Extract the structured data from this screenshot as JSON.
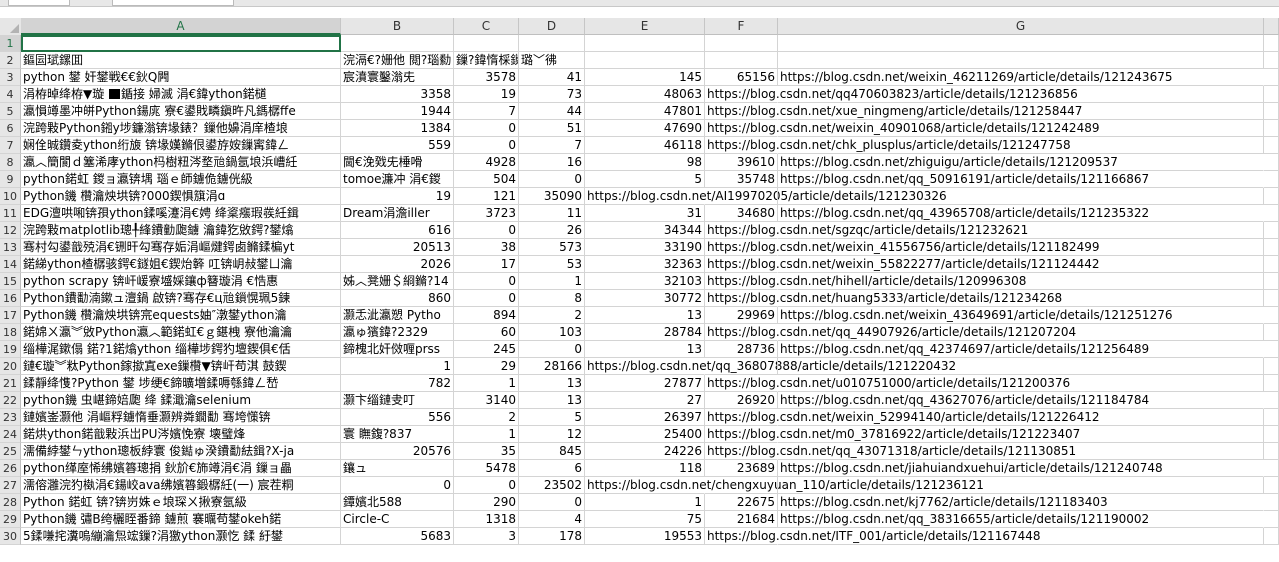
{
  "column_headers": [
    "A",
    "B",
    "C",
    "D",
    "E",
    "F",
    "G"
  ],
  "rows": [
    {
      "n": "1",
      "A": "",
      "B": "",
      "C": "",
      "D": "",
      "E": "",
      "F": "",
      "G": ""
    },
    {
      "n": "2",
      "A": "鏂囩珷鏍囬",
      "B": "浣滆€?姗他  閲?瑙勬",
      "C": "鏁?鍏惰棌鏁?",
      "D": "璐﹀彿",
      "E": "",
      "F": "",
      "G": ""
    },
    {
      "n": "3",
      "A": "python 鐢  奸鐢戦€€鈥Q闁",
      "B": "宸濆寰鑿滃兂",
      "C": "3578",
      "D": "41",
      "E": "145",
      "F": "65156",
      "G": "https://blog.csdn.net/weixin_46211269/article/details/121243675"
    },
    {
      "n": "4",
      "A": "涓栫晫绛栫▼璇  [■]鍎接  婦滅  涓€鍏ython鍩檤",
      "B": "3358",
      "C": "19",
      "D": "73",
      "E": "48063",
      "F": "https://blog.csdn.net/qq470603823/article/details/121236856",
      "G": ""
    },
    {
      "n": "5",
      "A": "瀛愪竴墨冲皏Python鍚庣  寮€鍙戝疄鎭旿凡鎷樼ffe",
      "B": "1944",
      "C": "7",
      "D": "44",
      "E": "47801",
      "F": "https://blog.csdn.net/xue_ningmeng/article/details/121258447",
      "G": ""
    },
    {
      "n": "6",
      "A": "浣跨敤Python鎺у埗鐮滃锛堟錶？鏁他嬶涓庠楂埌",
      "B": "1384",
      "C": "0",
      "D": "51",
      "E": "47690",
      "F": "https://blog.csdn.net/weixin_40901068/article/details/121242489",
      "G": ""
    },
    {
      "n": "7",
      "A": "娴佺晠鑽夌ython绗旇  锛堟嫨鏅佷鍙斿姲鏁寗鍏ㄥ",
      "B": "559",
      "C": "0",
      "D": "7",
      "E": "46118",
      "F": "https://blog.csdn.net/chk_plusplus/article/details/121247758",
      "G": ""
    },
    {
      "n": "8",
      "A": "瀛︿簡閬ｄ簺浠庨ython杩樹粈涔堥兘鍋氬埌浜嶆紝",
      "B": "閫€浼戣兂棰嗗",
      "C": "4928",
      "D": "16",
      "E": "98",
      "F": "39610",
      "G": "https://blog.csdn.net/zhiguigu/article/details/121209537"
    },
    {
      "n": "9",
      "A": "python鍩虹  鍐ョ瀛锛堣  瑙ｅ師鐪佹鐪侊級",
      "B": "tomoe濂冲  涓€鍐",
      "C": "504",
      "D": "0",
      "E": "5",
      "F": "35748",
      "G": "https://blog.csdn.net/qq_50916191/article/details/121166867"
    },
    {
      "n": "10",
      "A": "Python鐖  欑瀹炴垬锛?000鍥惧簱涓ɑ",
      "B": "19",
      "C": "121",
      "D": "35090",
      "E": "https://blog.csdn.net/AI19970205/article/details/121230326",
      "F": "",
      "G": ""
    },
    {
      "n": "11",
      "A": "EDG澶哄啝锛孭ython鍒嗘瀽涓€娉  绛楶瘬瑕彂紝鍓",
      "B": "Dream涓澹iller",
      "C": "3723",
      "D": "11",
      "E": "31",
      "F": "34680",
      "G": "https://blog.csdn.net/qq_43965708/article/details/121235322"
    },
    {
      "n": "12",
      "A": "浣跨敤matplotlib璁╀綘鐨勭瓟鐪  瀹鍏犵敓鍔?鐢熻",
      "B": "616",
      "C": "0",
      "D": "26",
      "E": "34344",
      "F": "https://blog.csdn.net/sgzqc/article/details/121232621",
      "G": ""
    },
    {
      "n": "13",
      "A": "骞村勾鍙戠殑涓€铏旰勾骞存姤涓嶇煡鍔卥鏅鍒楄yt",
      "B": "20513",
      "C": "38",
      "D": "573",
      "E": "33190",
      "F": "https://blog.csdn.net/weixin_41556756/article/details/121182499",
      "G": ""
    },
    {
      "n": "14",
      "A": "鍩綈ython楂樼骇鍔€鐩姐€鍥炲簳  叿锛岄敊鐢ㄩ瀹",
      "B": "2026",
      "C": "17",
      "D": "53",
      "E": "32363",
      "F": "https://blog.csdn.net/weixin_55822277/article/details/121124442",
      "G": ""
    },
    {
      "n": "15",
      "A": "python scrapy 锛屽嵈寮墭婇鑲ф簮璇涓  €悎惠",
      "B": "姊︿凳姗＄綗鏅?14",
      "C": "0",
      "D": "1",
      "E": "32103",
      "F": "https://blog.csdn.net/hihell/article/details/120996308",
      "G": ""
    },
    {
      "n": "16",
      "A": "Python鐨勫湳鏉ュ澶鍋  啟锛?骞存€ц兘鎻愰珮5鍊",
      "B": "860",
      "C": "0",
      "D": "8",
      "E": "30772",
      "F": "https://blog.csdn.net/huang5333/article/details/121234268",
      "G": ""
    },
    {
      "n": "17",
      "A": "Python鐖  欑瀹炴垬锛宺equests妯″潡鐢ython瀹",
      "B": "灏忎泚瀛愬  Pytho",
      "C": "894",
      "D": "2",
      "E": "13",
      "F": "29969",
      "G": "https://blog.csdn.net/weixin_43649691/article/details/121251276"
    },
    {
      "n": "18",
      "A": "鍩婂ㄨ瀛︾敓Python瀛︿範鍩虹€ｇ鍖栧  寮他瀹瀹",
      "B": "瀛ゅ獱鍏?2329",
      "C": "60",
      "D": "103",
      "E": "28784",
      "F": "https://blog.csdn.net/qq_44907926/article/details/121207204",
      "G": ""
    },
    {
      "n": "19",
      "A": "缁樺浘鏉傝  鍩?1鍩熻ython 缁樺埗鍔犳壇鍥俱€佸",
      "B": "鍗槐北奸傚喱prss",
      "C": "245",
      "D": "0",
      "E": "13",
      "F": "28736",
      "G": "https://blog.csdn.net/qq_42374697/article/details/121256489"
    },
    {
      "n": "20",
      "A": "鏈€璇︾粏Python鎵撳寘exe鏁欑▼锛屽苟淇  鼓鍥",
      "B": "1",
      "C": "29",
      "D": "28166",
      "E": "https://blog.csdn.net/qq_36807888/article/details/121220432",
      "F": "",
      "G": ""
    },
    {
      "n": "21",
      "A": "鍒靜绛愯?Python 鐢   埗绠€鍗曠増鍒嗕綔鍏ㄥ嵆",
      "B": "782",
      "C": "1",
      "D": "13",
      "E": "27877",
      "F": "https://blog.csdn.net/u010751000/article/details/121200376",
      "G": ""
    },
    {
      "n": "22",
      "A": "python鐖  虫嵁鍗婄瓟  绛  鍒濈瀹selenium",
      "B": "灏卞缁鏈叏叮",
      "C": "3140",
      "D": "13",
      "E": "27",
      "F": "26920",
      "G": "https://blog.csdn.net/qq_43627076/article/details/121184784"
    },
    {
      "n": "23",
      "A": "鏈嬪崟灏他  涓嶇粰鐪惰垂灏辨粦鐗勫  骞垮憡锛",
      "B": "556",
      "C": "2",
      "D": "5",
      "E": "26397",
      "F": "https://blog.csdn.net/weixin_52994140/article/details/121226412",
      "G": ""
    },
    {
      "n": "24",
      "A": "鍩烘ython鍩戠敤浜岀PU涔嬪悗寮  壊璧烽",
      "B": "寰  瞴鍑?837",
      "C": "1",
      "D": "12",
      "E": "25400",
      "F": "https://blog.csdn.net/m0_37816922/article/details/121223407",
      "G": ""
    },
    {
      "n": "25",
      "A": "濡備綍鐢ㄣython璁板綍寰  俊鐑ゅ湀鐨勫紶鍓?X-ja",
      "B": "20576",
      "C": "35",
      "D": "845",
      "E": "24226",
      "F": "https://blog.csdn.net/qq_43071318/article/details/121130851",
      "G": ""
    },
    {
      "n": "26",
      "A": "python缂庢悕绋嬪簭璁捐  鈥斺€斾竴涓€涓  鏁ョ畾",
      "B": "鑲ュ",
      "C": "5478",
      "D": "6",
      "E": "118",
      "F": "23689",
      "G": "https://blog.csdn.net/jiahuiandxuehui/article/details/121240748"
    },
    {
      "n": "27",
      "A": "濡傛灉浣犳槸涓€鍚峧ava绋嬪簭鍛樼紝(一)  宸茬粡",
      "B": "0",
      "C": "0",
      "D": "23502",
      "E": "https://blog.csdn.net/chengxuyuan_110/article/details/121236121",
      "F": "",
      "G": ""
    },
    {
      "n": "28",
      "A": "Python 鍩虹  锛?锛岃姝ｅ埌琛ㄨ揪寮氬級",
      "B": "鐔嬪北588",
      "C": "290",
      "D": "0",
      "E": "1",
      "F": "22675",
      "G": "https://blog.csdn.net/kj7762/article/details/121183403"
    },
    {
      "n": "29",
      "A": "Python鐖  彇B绔欐眰番鍗  鐪煎  褰曞苟鐢okeh鍩",
      "B": "Circle-C",
      "C": "1318",
      "D": "4",
      "E": "75",
      "F": "21684",
      "G": "https://blog.csdn.net/qq_38316655/article/details/121190002"
    },
    {
      "n": "30",
      "A": "5鍒嗛挓瀵嗚繃瀹炰竤鏁?涓獥ython灏忔  鍒  紆鐢",
      "B": "5683",
      "C": "3",
      "D": "178",
      "E": "19553",
      "F": "https://blog.csdn.net/ITF_001/article/details/121167448",
      "G": ""
    }
  ]
}
